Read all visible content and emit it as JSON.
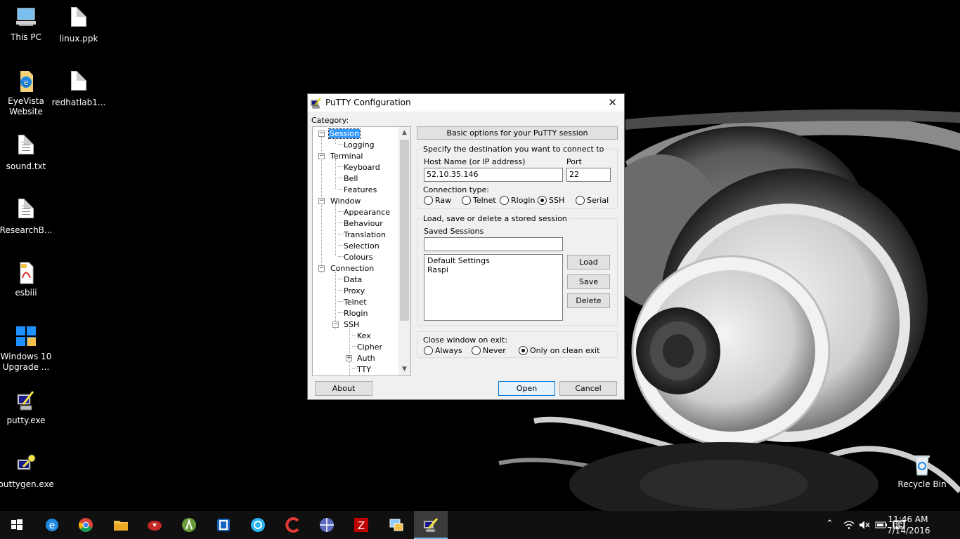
{
  "desktop": {
    "icons": [
      {
        "label": "This PC",
        "icon": "computer-icon"
      },
      {
        "label": "linux.ppk",
        "icon": "file-icon"
      },
      {
        "label": "EyeVista Website",
        "icon": "edge-shortcut-icon"
      },
      {
        "label": "redhatlab1...",
        "icon": "file-icon"
      },
      {
        "label": "sound.txt",
        "icon": "text-file-icon"
      },
      {
        "label": "ResearchB...",
        "icon": "text-file-icon"
      },
      {
        "label": "esbiii",
        "icon": "pdf-icon"
      },
      {
        "label": "Windows 10 Upgrade ...",
        "icon": "windows-icon"
      },
      {
        "label": "putty.exe",
        "icon": "putty-icon"
      },
      {
        "label": "puttygen.exe",
        "icon": "puttygen-icon"
      },
      {
        "label": "Recycle Bin",
        "icon": "recycle-bin-icon"
      }
    ]
  },
  "putty": {
    "title": "PuTTY Configuration",
    "close_glyph": "✕",
    "category_label": "Category:",
    "tree": [
      {
        "label": "Session",
        "selected": true
      },
      {
        "label": "Logging"
      },
      {
        "label": "Terminal"
      },
      {
        "label": "Keyboard"
      },
      {
        "label": "Bell"
      },
      {
        "label": "Features"
      },
      {
        "label": "Window"
      },
      {
        "label": "Appearance"
      },
      {
        "label": "Behaviour"
      },
      {
        "label": "Translation"
      },
      {
        "label": "Selection"
      },
      {
        "label": "Colours"
      },
      {
        "label": "Connection"
      },
      {
        "label": "Data"
      },
      {
        "label": "Proxy"
      },
      {
        "label": "Telnet"
      },
      {
        "label": "Rlogin"
      },
      {
        "label": "SSH"
      },
      {
        "label": "Kex"
      },
      {
        "label": "Cipher"
      },
      {
        "label": "Auth"
      },
      {
        "label": "TTY"
      }
    ],
    "panel_title": "Basic options for your PuTTY session",
    "destination": {
      "group_label": "Specify the destination you want to connect to",
      "host_label": "Host Name (or IP address)",
      "host_value": "52.10.35.146",
      "port_label": "Port",
      "port_value": "22",
      "conn_type_label": "Connection type:",
      "conn_types": [
        "Raw",
        "Telnet",
        "Rlogin",
        "SSH",
        "Serial"
      ],
      "conn_selected": "SSH"
    },
    "sessions": {
      "group_label": "Load, save or delete a stored session",
      "saved_label": "Saved Sessions",
      "saved_value": "",
      "list": [
        "Default Settings",
        "Raspi"
      ],
      "load_label": "Load",
      "save_label": "Save",
      "delete_label": "Delete"
    },
    "close_on_exit": {
      "label": "Close window on exit:",
      "options": [
        "Always",
        "Never",
        "Only on clean exit"
      ],
      "selected": "Only on clean exit"
    },
    "about_label": "About",
    "open_label": "Open",
    "cancel_label": "Cancel"
  },
  "taskbar": {
    "apps": [
      "start-icon",
      "edge-icon",
      "chrome-icon",
      "file-explorer-icon",
      "app-red-icon",
      "android-studio-icon",
      "app-square-icon",
      "app-blue-circle-icon",
      "ccleaner-icon",
      "network-icon",
      "filezilla-icon",
      "app-monitor-icon",
      "putty-icon"
    ],
    "active_app": "putty-icon",
    "time": "11:46 AM",
    "date": "7/14/2016"
  },
  "colors": {
    "desktop_bg": "#000000",
    "taskbar_bg": "#101010",
    "accent": "#0078d7",
    "selection": "#3399ff"
  }
}
